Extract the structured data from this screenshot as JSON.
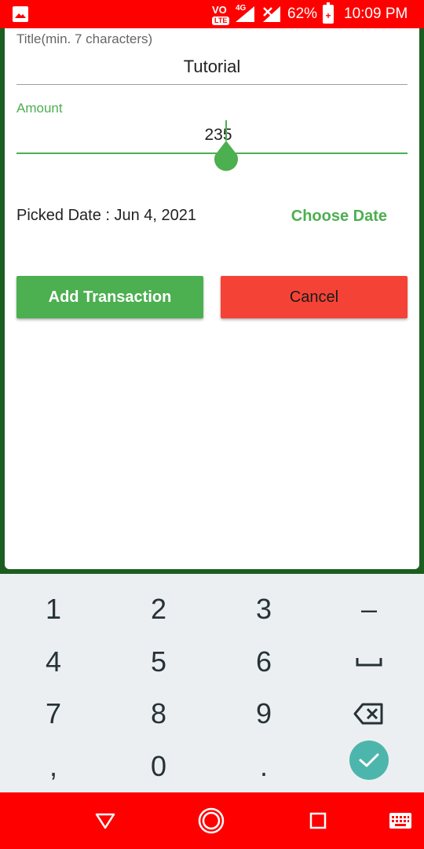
{
  "status_bar": {
    "volte_label": "VO",
    "lte_label": "LTE",
    "network_label": "4G",
    "battery_percent": "62%",
    "time": "10:09 PM"
  },
  "form": {
    "title_label": "Title(min. 7 characters)",
    "title_value": "Tutorial",
    "amount_label": "Amount",
    "amount_value": "235",
    "picked_date_text": "Picked Date : Jun 4, 2021",
    "choose_date_label": "Choose Date",
    "add_button_label": "Add Transaction",
    "cancel_button_label": "Cancel"
  },
  "keyboard": {
    "keys": [
      "1",
      "2",
      "3",
      "–",
      "4",
      "5",
      "6",
      "7",
      "8",
      "9",
      ",",
      "0",
      "."
    ]
  },
  "colors": {
    "accent_green": "#4caf50",
    "cancel_red": "#f44336",
    "status_bar": "#ff0000",
    "keyboard_bg": "#eceff1",
    "enter_key": "#4db6ac"
  }
}
